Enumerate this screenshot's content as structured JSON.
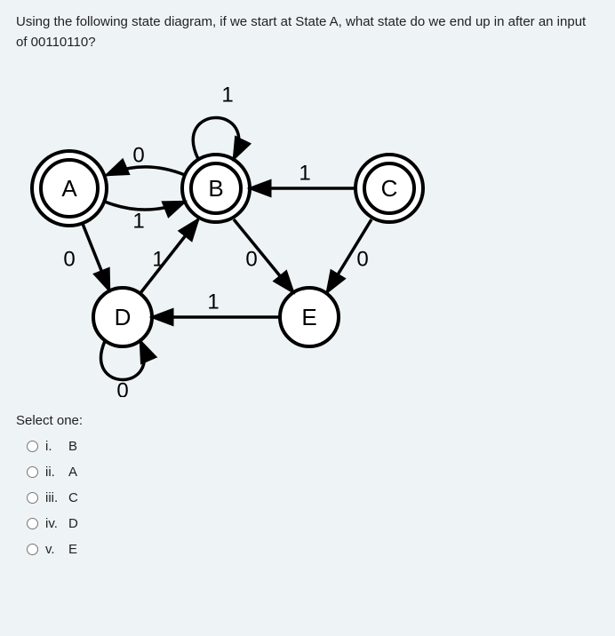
{
  "question": "Using the following state diagram, if we start at State A, what state do we end up in after an input of 00110110?",
  "states": {
    "A": "A",
    "B": "B",
    "C": "C",
    "D": "D",
    "E": "E"
  },
  "edges": {
    "b_self_1": "1",
    "b_to_a_0": "0",
    "a_to_b_1": "1",
    "c_to_b_1": "1",
    "a_to_d_0": "0",
    "d_to_b_1": "1",
    "b_to_e_0": "0",
    "c_to_e_0": "0",
    "e_to_d_1": "1",
    "d_self_0": "0"
  },
  "select_one": "Select one:",
  "options": [
    {
      "num": "i.",
      "label": "B"
    },
    {
      "num": "ii.",
      "label": "A"
    },
    {
      "num": "iii.",
      "label": "C"
    },
    {
      "num": "iv.",
      "label": "D"
    },
    {
      "num": "v.",
      "label": "E"
    }
  ]
}
